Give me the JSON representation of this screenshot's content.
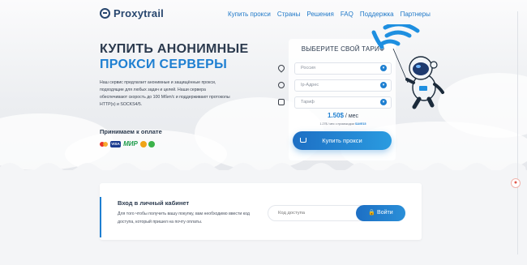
{
  "brand": {
    "name": "Proxytrail"
  },
  "nav": [
    {
      "label": "Купить прокси"
    },
    {
      "label": "Страны"
    },
    {
      "label": "Решения"
    },
    {
      "label": "FAQ"
    },
    {
      "label": "Поддержка"
    },
    {
      "label": "Партнеры"
    }
  ],
  "hero": {
    "title_line1": "Купить анонимные",
    "title_line2": "прокси серверы",
    "description": "Наш сервис предлагает анонимные и защищённые прокси, подходящие для любых задач и целей. Наши сервера обеспечивают скорость до 100 Мбит/с и поддерживают протоколы HTTP(s) и SOCKS4/5.",
    "accept_title": "Принимаем к оплате",
    "payment_icons": [
      "mastercard-icon",
      "visa-icon",
      "mir-icon",
      "coin-icon",
      "coin-icon"
    ]
  },
  "tariff": {
    "title": "Выберите свой тариф",
    "country_value": "Россия",
    "type_value": "Ip-Адрес",
    "period_value": "Тариф",
    "price": "1.50$",
    "price_unit": " / мес",
    "promo_text": "1.27$ / мес с промокодом ",
    "promo_code": "SAVE15",
    "buy_label": "Купить прокси"
  },
  "login": {
    "title": "Вход в личный кабинет",
    "description": "Для того чтобы получить вашу покупку, вам необходимо ввести код доступа, который пришел на почту оплаты.",
    "input_placeholder": "Код доступа",
    "button_label": "Войти"
  },
  "colors": {
    "accent": "#1e7fd1",
    "dark": "#2b3a4e"
  }
}
